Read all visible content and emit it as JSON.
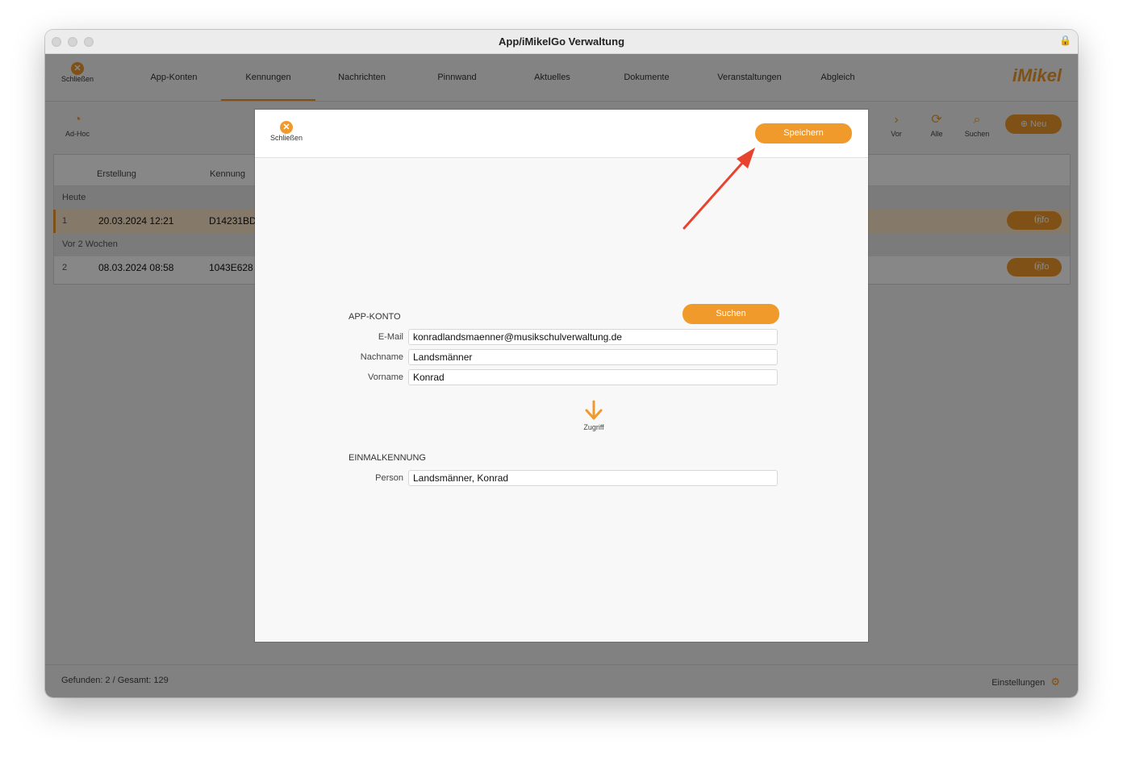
{
  "window": {
    "title": "App/iMikelGo Verwaltung"
  },
  "nav": {
    "close_label": "Schließen",
    "tabs": [
      {
        "label": "App-Konten"
      },
      {
        "label": "Kennungen"
      },
      {
        "label": "Nachrichten"
      },
      {
        "label": "Pinnwand"
      },
      {
        "label": "Aktuelles"
      },
      {
        "label": "Dokumente"
      },
      {
        "label": "Veranstaltungen"
      },
      {
        "label": "Abgleich"
      }
    ],
    "active_tab": "Kennungen",
    "logo": "iMikel"
  },
  "toolbar": {
    "adhoc_label": "Ad-Hoc",
    "vor_label": "Vor",
    "alle_label": "Alle",
    "suchen_label": "Suchen",
    "neu_label": "Neu"
  },
  "grid": {
    "columns": [
      "Erstellung",
      "Kennung"
    ],
    "groups": [
      {
        "label": "Heute",
        "rows": [
          {
            "num": "1",
            "erstellung": "20.03.2024 12:21",
            "kennung": "D14231BD",
            "info": "Info",
            "selected": true
          }
        ]
      },
      {
        "label": "Vor 2 Wochen",
        "rows": [
          {
            "num": "2",
            "erstellung": "08.03.2024 08:58",
            "kennung": "1043E628",
            "info": "Info",
            "selected": false
          }
        ]
      }
    ]
  },
  "status": {
    "found": "Gefunden: 2 / Gesamt: 129",
    "settings": "Einstellungen"
  },
  "modal": {
    "close_label": "Schließen",
    "save_label": "Speichern",
    "app_konto": {
      "heading": "APP-KONTO",
      "search_label": "Suchen",
      "email_label": "E-Mail",
      "email_value": "konradlandsmaenner@musikschulverwaltung.de",
      "nachname_label": "Nachname",
      "nachname_value": "Landsmänner",
      "vorname_label": "Vorname",
      "vorname_value": "Konrad"
    },
    "zugriff_label": "Zugriff",
    "einmalkennung": {
      "heading": "EINMALKENNUNG",
      "person_label": "Person",
      "person_value": "Landsmänner, Konrad"
    }
  },
  "colors": {
    "accent": "#f09a2b",
    "annotation_arrow": "#e8432f"
  }
}
